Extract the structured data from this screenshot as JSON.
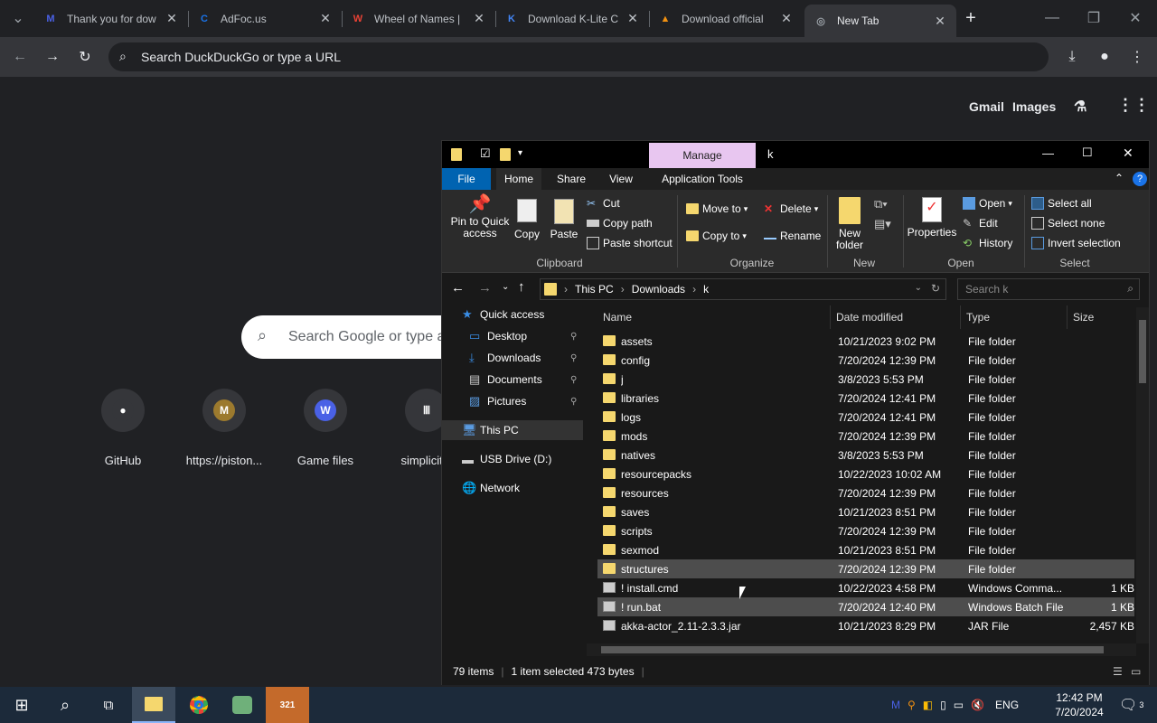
{
  "browser": {
    "tabs": [
      {
        "title": "Thank you for dow",
        "favicon": "M",
        "color": "#4a61e6"
      },
      {
        "title": "AdFoc.us",
        "favicon": "C",
        "color": "#1a73e8"
      },
      {
        "title": "Wheel of Names |",
        "favicon": "W",
        "color": "#e94235"
      },
      {
        "title": "Download K-Lite C",
        "favicon": "K",
        "color": "#4285f4"
      },
      {
        "title": "Download official",
        "favicon": "▲",
        "color": "#f29111"
      },
      {
        "title": "New Tab",
        "favicon": "◎",
        "color": "#9aa0a6"
      }
    ],
    "new_tab_symbol": "+",
    "omnibox_placeholder": "Search DuckDuckGo or type a URL"
  },
  "ntp": {
    "gmail": "Gmail",
    "images": "Images",
    "search_placeholder": "Search Google or type a",
    "shortcuts": [
      {
        "label": "GitHub",
        "icon": "github-icon",
        "glyph": "●"
      },
      {
        "label": "https://piston...",
        "icon": "m-icon",
        "glyph": "M"
      },
      {
        "label": "Game files",
        "icon": "w-icon",
        "glyph": "W"
      },
      {
        "label": "simplicityr",
        "icon": "institution-icon",
        "glyph": "Ⅲ"
      }
    ]
  },
  "explorer": {
    "title": "k",
    "manage": "Manage",
    "ribbon_tabs": [
      "File",
      "Home",
      "Share",
      "View",
      "Application Tools"
    ],
    "clipboard": {
      "pin": "Pin to Quick access",
      "copy": "Copy",
      "paste": "Paste",
      "cut": "Cut",
      "copy_path": "Copy path",
      "paste_shortcut": "Paste shortcut",
      "group": "Clipboard"
    },
    "organize": {
      "move_to": "Move to",
      "copy_to": "Copy to",
      "delete": "Delete",
      "rename": "Rename",
      "group": "Organize"
    },
    "new": {
      "new_folder": "New folder",
      "group": "New"
    },
    "open": {
      "properties": "Properties",
      "open": "Open",
      "edit": "Edit",
      "history": "History",
      "group": "Open"
    },
    "select": {
      "select_all": "Select all",
      "select_none": "Select none",
      "invert": "Invert selection",
      "group": "Select"
    },
    "breadcrumb": [
      "This PC",
      "Downloads",
      "k"
    ],
    "search_placeholder": "Search k",
    "nav": [
      {
        "label": "Quick access",
        "pinned": false
      },
      {
        "label": "Desktop",
        "pinned": true
      },
      {
        "label": "Downloads",
        "pinned": true
      },
      {
        "label": "Documents",
        "pinned": true
      },
      {
        "label": "Pictures",
        "pinned": true
      },
      {
        "label": "This PC",
        "pinned": false
      },
      {
        "label": "USB Drive (D:)",
        "pinned": false
      },
      {
        "label": "Network",
        "pinned": false
      }
    ],
    "columns": [
      "Name",
      "Date modified",
      "Type",
      "Size"
    ],
    "files": [
      {
        "name": "assets",
        "date": "10/21/2023 9:02 PM",
        "type": "File folder",
        "size": ""
      },
      {
        "name": "config",
        "date": "7/20/2024 12:39 PM",
        "type": "File folder",
        "size": ""
      },
      {
        "name": "j",
        "date": "3/8/2023 5:53 PM",
        "type": "File folder",
        "size": ""
      },
      {
        "name": "libraries",
        "date": "7/20/2024 12:41 PM",
        "type": "File folder",
        "size": ""
      },
      {
        "name": "logs",
        "date": "7/20/2024 12:41 PM",
        "type": "File folder",
        "size": ""
      },
      {
        "name": "mods",
        "date": "7/20/2024 12:39 PM",
        "type": "File folder",
        "size": ""
      },
      {
        "name": "natives",
        "date": "3/8/2023 5:53 PM",
        "type": "File folder",
        "size": ""
      },
      {
        "name": "resourcepacks",
        "date": "10/22/2023 10:02 AM",
        "type": "File folder",
        "size": ""
      },
      {
        "name": "resources",
        "date": "7/20/2024 12:39 PM",
        "type": "File folder",
        "size": ""
      },
      {
        "name": "saves",
        "date": "10/21/2023 8:51 PM",
        "type": "File folder",
        "size": ""
      },
      {
        "name": "scripts",
        "date": "7/20/2024 12:39 PM",
        "type": "File folder",
        "size": ""
      },
      {
        "name": "sexmod",
        "date": "10/21/2023 8:51 PM",
        "type": "File folder",
        "size": ""
      },
      {
        "name": "structures",
        "date": "7/20/2024 12:39 PM",
        "type": "File folder",
        "size": ""
      },
      {
        "name": "! install.cmd",
        "date": "10/22/2023 4:58 PM",
        "type": "Windows Comma...",
        "size": "1 KB"
      },
      {
        "name": "! run.bat",
        "date": "7/20/2024 12:40 PM",
        "type": "Windows Batch File",
        "size": "1 KB"
      },
      {
        "name": "akka-actor_2.11-2.3.3.jar",
        "date": "10/21/2023 8:29 PM",
        "type": "JAR File",
        "size": "2,457 KB"
      }
    ],
    "status": {
      "items": "79 items",
      "selected": "1 item selected  473 bytes"
    }
  },
  "taskbar": {
    "time": "12:42 PM",
    "date": "7/20/2024",
    "lang": "ENG",
    "notif": "3"
  }
}
